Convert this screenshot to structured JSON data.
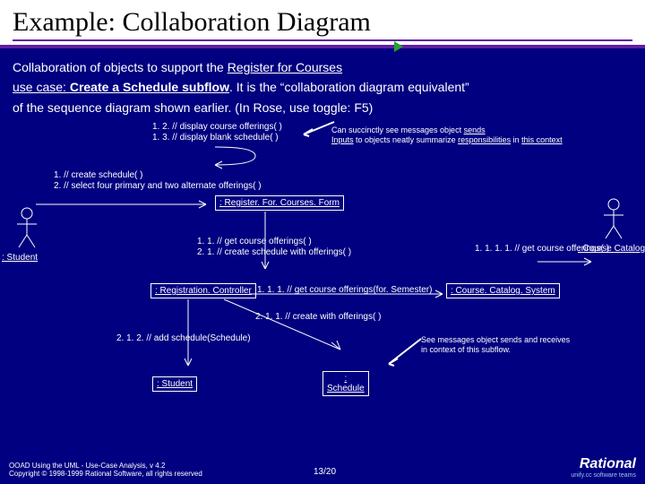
{
  "title": "Example: Collaboration Diagram",
  "desc_line1_a": "Collaboration of objects to support the ",
  "desc_line1_b": "Register for Courses",
  "desc_line2_a": "use case: ",
  "desc_line2_b": "Create a Schedule subflow",
  "desc_line2_c": ". It is the “collaboration diagram equivalent”",
  "desc_line3": "of the sequence diagram shown earlier.   (In Rose, use toggle: F5)",
  "msg_1_2": "1. 2. // display course offerings( )",
  "msg_1_3": "1. 3. // display blank schedule( )",
  "note_top_a": "Can succinctly see messages object ",
  "note_top_b": "sends",
  "note_top_c": "Inputs",
  "note_top_d": " to objects neatly summarize ",
  "note_top_e": "responsibilities",
  "note_top_f": " in ",
  "note_top_g": "this context",
  "msg_1": "1. // create schedule( )",
  "msg_2": "2. // select four primary and two alternate offerings( )",
  "obj_form": ": Register. For. Courses. Form",
  "actor_student": ": Student",
  "actor_catalog": ": Course Catalog",
  "msg_1_1": "1. 1. // get course offerings( )",
  "msg_2_1": "2. 1. // create schedule with offerings( )",
  "msg_1111": "1. 1. 1. 1. // get course offerings( )",
  "obj_controller": ": Registration. Controller",
  "msg_111": "1. 1. 1. // get course offerings(for. Semester)",
  "obj_ccs": ": Course. Catalog. System",
  "msg_211": "2. 1. 1. // create with offerings( )",
  "msg_212": "2. 1. 2. // add schedule(Schedule)",
  "obj_student": ": Student",
  "obj_schedule_a": ":",
  "obj_schedule_b": "Schedule",
  "note_bottom": "See messages object sends and receives\nin context of this subflow.",
  "copyright1": "OOAD Using the UML - Use-Case Analysis, v 4.2",
  "copyright2": "Copyright © 1998-1999 Rational Software, all rights reserved",
  "pager": "13/20",
  "logo_brand": "Rational",
  "logo_tag": "unify.cc software teams"
}
